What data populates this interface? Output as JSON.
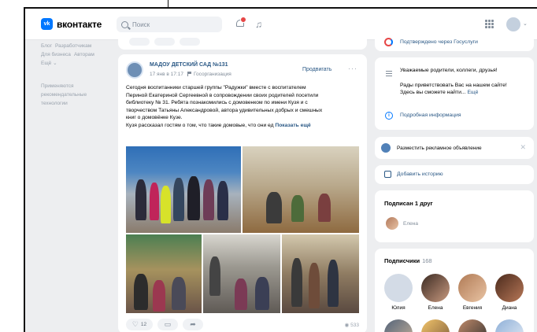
{
  "header": {
    "logo_text": "вконтакте",
    "logo_mark": "vk",
    "search_placeholder": "Поиск"
  },
  "leftnav": {
    "row1": [
      "Блог",
      "Разработчикам"
    ],
    "row2": [
      "Для бизнеса",
      "Авторам"
    ],
    "row3": [
      "Ещё ⌄"
    ],
    "rec": [
      "Применяются",
      "рекомендательные",
      "технологии"
    ]
  },
  "post": {
    "author": "МАДОУ ДЕТСКИЙ САД №131",
    "date": "17 янв в 17:17",
    "badge": "Госорганизация",
    "promote_label": "Продвигать",
    "more": "···",
    "text_lines": [
      "Сегодня воспитанники старшей группы \"Радужки\" вместе с воспитателем",
      "Периной Екатериной Сергеевной в сопровождении своих родителей посетили",
      "библиотеку № 31. Ребята познакомились с домовенком по имени Кузя и с",
      "творчеством Татьяны Александровой, автора удивительных добрых и смешных",
      "книг о домовёнке Кузе."
    ],
    "last_line": "Кузя рассказал гостям о том, что такие домовые, что они ед",
    "show_more": "Показать ещё",
    "likes": "12",
    "views": "533"
  },
  "right": {
    "gos_text": "Подтверждено через Госуслуги",
    "about_title": "Уважаемые родители, коллеги, друзья!",
    "about_text1": "Рады приветствовать Вас на нашем сайте!",
    "about_text2": "Здесь вы сможете найти...",
    "about_more": "Ещё",
    "info_link": "Подробная информация",
    "ads_text": "Разместить рекламное объявление",
    "history_text": "Добавить историю",
    "friends_title": "Подписан 1 друг",
    "friend_name": "Елена",
    "subs_title": "Подписчики",
    "subs_count": "168",
    "subscribers": [
      "Юлия",
      "Елена",
      "Евгения",
      "Диана"
    ]
  }
}
